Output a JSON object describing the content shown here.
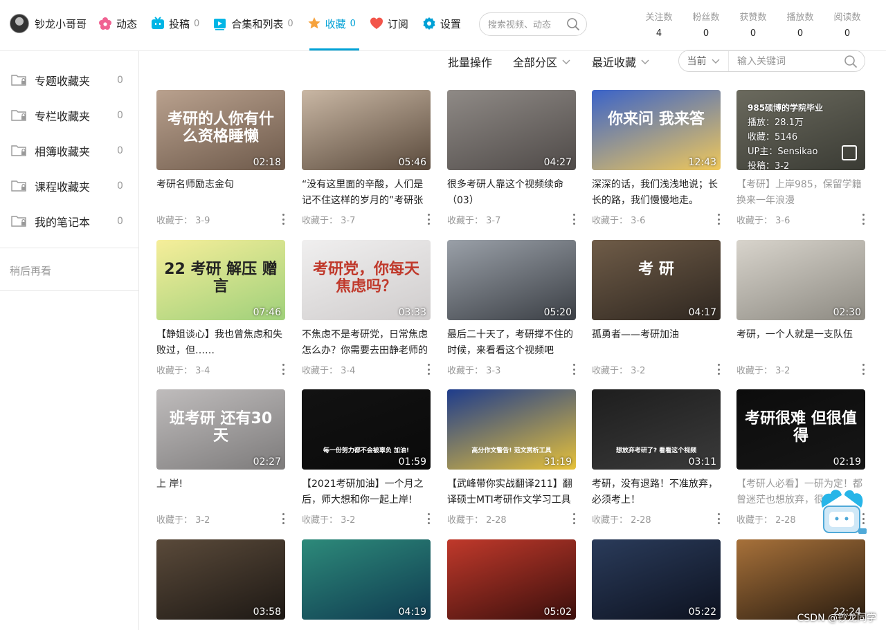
{
  "header": {
    "username": "钞龙小哥哥",
    "nav": [
      {
        "label": "动态",
        "count": "",
        "icon": "flower-icon",
        "color": "#f06292"
      },
      {
        "label": "投稿",
        "count": "0",
        "icon": "upload-tv-icon",
        "color": "#00b5e5"
      },
      {
        "label": "合集和列表",
        "count": "0",
        "icon": "playlist-icon",
        "color": "#00b5e5"
      },
      {
        "label": "收藏",
        "count": "0",
        "icon": "star-icon",
        "color": "#f6a23c",
        "active": true
      },
      {
        "label": "订阅",
        "count": "",
        "icon": "heart-icon",
        "color": "#f2554a"
      },
      {
        "label": "设置",
        "count": "",
        "icon": "gear-icon",
        "color": "#00a1d6"
      }
    ],
    "search_placeholder": "搜索视频、动态",
    "stats": [
      {
        "label": "关注数",
        "value": "4"
      },
      {
        "label": "粉丝数",
        "value": "0"
      },
      {
        "label": "获赞数",
        "value": "0"
      },
      {
        "label": "播放数",
        "value": "0"
      },
      {
        "label": "阅读数",
        "value": "0"
      }
    ]
  },
  "sidebar": {
    "items": [
      {
        "label": "专题收藏夹",
        "count": "0"
      },
      {
        "label": "专栏收藏夹",
        "count": "0"
      },
      {
        "label": "相簿收藏夹",
        "count": "0"
      },
      {
        "label": "课程收藏夹",
        "count": "0"
      },
      {
        "label": "我的笔记本",
        "count": "0"
      }
    ],
    "watch_later": "稍后再看"
  },
  "toolbar": {
    "batch": "批量操作",
    "zone": "全部分区",
    "sort": "最近收藏",
    "scope": "当前",
    "keyword_placeholder": "输入关键词"
  },
  "videos": [
    {
      "title": "考研名师励志金句",
      "duration": "02:18",
      "fav": "收藏于：  3-9",
      "overlay": "考研的人你有什么资格睡懒",
      "colors": [
        "#b9a18e",
        "#6e5a4b"
      ]
    },
    {
      "title": "“没有这里面的辛酸，人们是记不住这样的岁月的”考研张",
      "duration": "05:46",
      "fav": "收藏于：  3-7",
      "overlay": "",
      "colors": [
        "#c9b7a4",
        "#5a4a3c"
      ]
    },
    {
      "title": "很多考研人靠这个视频续命（03）",
      "duration": "04:27",
      "fav": "收藏于：  3-7",
      "overlay": "",
      "colors": [
        "#8f8a86",
        "#4f4a48"
      ]
    },
    {
      "title": "深深的话，我们浅浅地说；长长的路，我们慢慢地走。",
      "duration": "12:43",
      "fav": "收藏于：  3-6",
      "overlay": "你来问 我来答",
      "colors": [
        "#3a63c9",
        "#f0c85a"
      ]
    },
    {
      "title": "【考研】上岸985，保留学籍换来一年浪漫",
      "duration": "",
      "fav": "收藏于：  3-6",
      "overlay": "",
      "colors": [
        "#6b6a5e",
        "#3a3b34"
      ],
      "dim": true,
      "hover": [
        "播放：28.1万",
        "收藏：5146",
        "UP主：Sensikao",
        "投稿：3-2"
      ],
      "hover_title": "985硕博的学院毕业"
    },
    {
      "title": "【静姐谈心】我也曾焦虑和失败过，但……",
      "duration": "07:46",
      "fav": "收藏于：  3-4",
      "overlay": "22 考研 解压 赠言",
      "colors": [
        "#f6ee9a",
        "#9fd07a"
      ]
    },
    {
      "title": "不焦虑不是考研党，日常焦虑怎么办？你需要去田静老师的",
      "duration": "03:33",
      "fav": "收藏于：  3-4",
      "overlay": "考研党，你每天焦虑吗？",
      "colors": [
        "#f0efef",
        "#cfcccc"
      ]
    },
    {
      "title": "最后二十天了，考研撑不住的时候，来看看这个视频吧",
      "duration": "05:20",
      "fav": "收藏于：  3-3",
      "overlay": "",
      "colors": [
        "#9aa0a8",
        "#3b3f45"
      ]
    },
    {
      "title": "孤勇者——考研加油",
      "duration": "04:17",
      "fav": "收藏于：  3-2",
      "overlay": "考 研",
      "colors": [
        "#6f5c48",
        "#2f2720"
      ]
    },
    {
      "title": "考研，一个人就是一支队伍",
      "duration": "02:30",
      "fav": "收藏于：  3-2",
      "overlay": "",
      "colors": [
        "#d8d4cc",
        "#8d8a82"
      ]
    },
    {
      "title": "上 岸!",
      "duration": "02:27",
      "fav": "收藏于：  3-2",
      "overlay": "班考研 还有30天",
      "colors": [
        "#bfbcbc",
        "#7d7b7b"
      ]
    },
    {
      "title": "【2021考研加油】一个月之后，师大想和你一起上岸!",
      "duration": "01:59",
      "fav": "收藏于：  3-2",
      "overlay": "每一份努力都不会被辜负 加油!",
      "colors": [
        "#121212",
        "#0a0a0a"
      ]
    },
    {
      "title": "【武峰带你实战翻译211】翻译硕士MTI考研作文学习工具",
      "duration": "31:19",
      "fav": "收藏于：  2-28",
      "overlay": "高分作文警告! 范文赏析工具",
      "colors": [
        "#1e3c8c",
        "#e6c13a"
      ]
    },
    {
      "title": "考研，没有退路！不准放弃，必须考上！",
      "duration": "03:11",
      "fav": "收藏于：  2-28",
      "overlay": "想放弃考研了? 看看这个视频",
      "colors": [
        "#1e1e1e",
        "#3a3a3a"
      ]
    },
    {
      "title": "【考研人必看】一研为定！都曾迷茫也想放弃，很",
      "duration": "02:19",
      "fav": "收藏于：  2-28",
      "overlay": "考研很难 但很值得",
      "colors": [
        "#0c0c0c",
        "#161616"
      ],
      "dim": true
    },
    {
      "title": "",
      "duration": "03:58",
      "fav": "",
      "overlay": "",
      "colors": [
        "#5a4a3a",
        "#1d1814"
      ]
    },
    {
      "title": "",
      "duration": "04:19",
      "fav": "",
      "overlay": "",
      "colors": [
        "#2d8a7a",
        "#0f3a50"
      ]
    },
    {
      "title": "",
      "duration": "05:02",
      "fav": "",
      "overlay": "",
      "colors": [
        "#c0392b",
        "#3b0f0c"
      ]
    },
    {
      "title": "",
      "duration": "05:22",
      "fav": "",
      "overlay": "",
      "colors": [
        "#2a3b5a",
        "#0d1220"
      ]
    },
    {
      "title": "",
      "duration": "22:24",
      "fav": "",
      "overlay": "",
      "colors": [
        "#a7713a",
        "#2b1d10"
      ]
    }
  ],
  "watermark": "CSDN @钞龙同学"
}
